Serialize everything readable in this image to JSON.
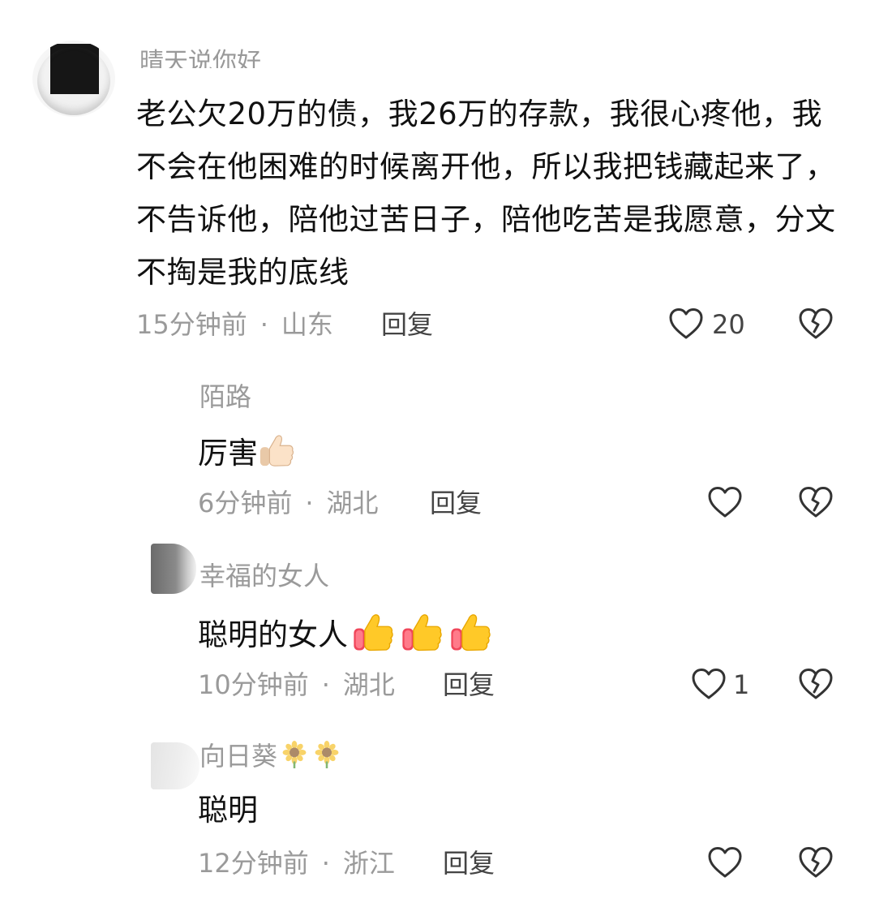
{
  "main_comment": {
    "username_partial": "晴天说你好",
    "text": "老公欠20万的债，我26万的存款，我很心疼他，我不会在他困难的时候离开他，所以我把钱藏起来了，不告诉他，陪他过苦日子，陪他吃苦是我愿意，分文不掏是我的底线",
    "time": "15分钟前",
    "location": "山东",
    "reply_label": "回复",
    "like_count": "20"
  },
  "replies": [
    {
      "username": "陌路",
      "text": "厉害",
      "emoji": [
        "thumbs-up-light"
      ],
      "time": "6分钟前",
      "location": "湖北",
      "reply_label": "回复",
      "like_count": ""
    },
    {
      "username": "幸福的女人",
      "text": "聪明的女人",
      "emoji": [
        "thumbs-up",
        "thumbs-up",
        "thumbs-up"
      ],
      "time": "10分钟前",
      "location": "湖北",
      "reply_label": "回复",
      "like_count": "1"
    },
    {
      "username": "向日葵",
      "username_emoji": [
        "sunflower",
        "sunflower"
      ],
      "text": "聪明",
      "time": "12分钟前",
      "location": "浙江",
      "reply_label": "回复",
      "like_count": ""
    }
  ],
  "separator": "·",
  "icons": {
    "like": "heart-outline-icon",
    "dislike": "broken-heart-icon"
  },
  "colors": {
    "text": "#111111",
    "meta": "#9a9a9a",
    "icon": "#333333"
  }
}
